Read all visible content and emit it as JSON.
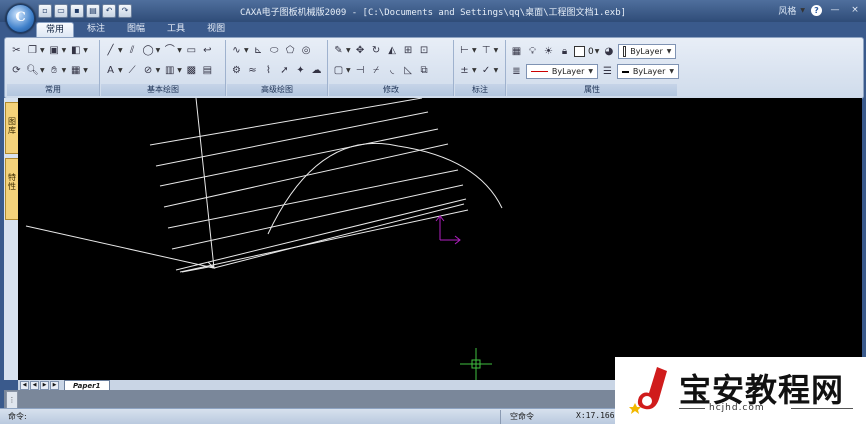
{
  "window": {
    "title": "CAXA电子图板机械版2009 - [C:\\Documents and Settings\\qq\\桌面\\工程图文档1.exb]",
    "user": "风格",
    "help": "?",
    "minimize": "—",
    "close": "×"
  },
  "app_logo": "C",
  "quick_access": [
    "new-icon",
    "open-icon",
    "save-icon",
    "print-icon",
    "undo-icon",
    "redo-icon"
  ],
  "ribbon": {
    "tabs": [
      {
        "label": "常用",
        "active": true
      },
      {
        "label": "标注",
        "active": false
      },
      {
        "label": "图幅",
        "active": false
      },
      {
        "label": "工具",
        "active": false
      },
      {
        "label": "视图",
        "active": false
      }
    ],
    "groups": [
      {
        "label": "常用"
      },
      {
        "label": "基本绘图"
      },
      {
        "label": "高级绘图"
      },
      {
        "label": "修改"
      },
      {
        "label": "标注"
      },
      {
        "label": "属性"
      }
    ],
    "properties": {
      "layer_value": "ByLayer",
      "linetype_value": "ByLayer",
      "lineweight_value": "ByLayer",
      "color_value": "ByLayer",
      "layer_number": "0",
      "linetype_color": "#cc0000"
    }
  },
  "left_panel": {
    "tabs": [
      "图库",
      "特性"
    ]
  },
  "canvas": {
    "background": "#000000",
    "line_color": "#e8e8e8",
    "ucs_color": "#b020c0",
    "cursor_color": "#40c040"
  },
  "sheets": {
    "active": "Paper1"
  },
  "status": {
    "command_label": "命令:",
    "command_state": "空命令",
    "coordinates": "X:17.1667,"
  },
  "watermark": {
    "name": "宝安教程网",
    "url": "hcjhd.com"
  }
}
